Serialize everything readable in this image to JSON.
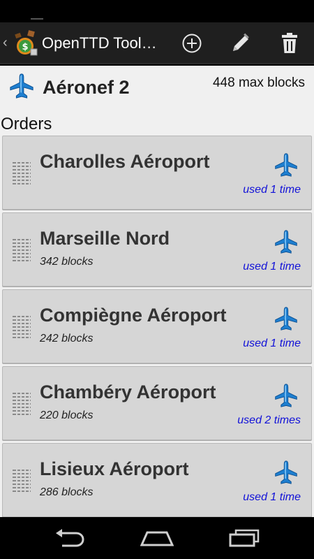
{
  "app": {
    "title": "OpenTTD Tool…"
  },
  "vehicle": {
    "name": "Aéronef 2",
    "max_blocks": "448 max blocks",
    "icon": "airplane-icon"
  },
  "orders_label": "Orders",
  "orders": [
    {
      "station": "Charolles Aéroport",
      "distance": "",
      "used": "used 1 time"
    },
    {
      "station": "Marseille Nord",
      "distance": "342 blocks",
      "used": "used 1 time"
    },
    {
      "station": "Compiègne Aéroport",
      "distance": "242 blocks",
      "used": "used 1 time"
    },
    {
      "station": "Chambéry Aéroport",
      "distance": "220 blocks",
      "used": "used 2 times"
    },
    {
      "station": "Lisieux Aéroport",
      "distance": "286 blocks",
      "used": "used 1 time"
    }
  ],
  "colors": {
    "accent_blue": "#1212d8",
    "plane_blue": "#1e7fd0",
    "card_bg": "#d6d6d6",
    "action_bar": "#1f1f1f"
  },
  "icons": {
    "add": "add-circle-icon",
    "edit": "pencil-icon",
    "delete": "trash-icon",
    "back": "back-icon",
    "home": "home-icon",
    "recent": "recent-apps-icon"
  }
}
